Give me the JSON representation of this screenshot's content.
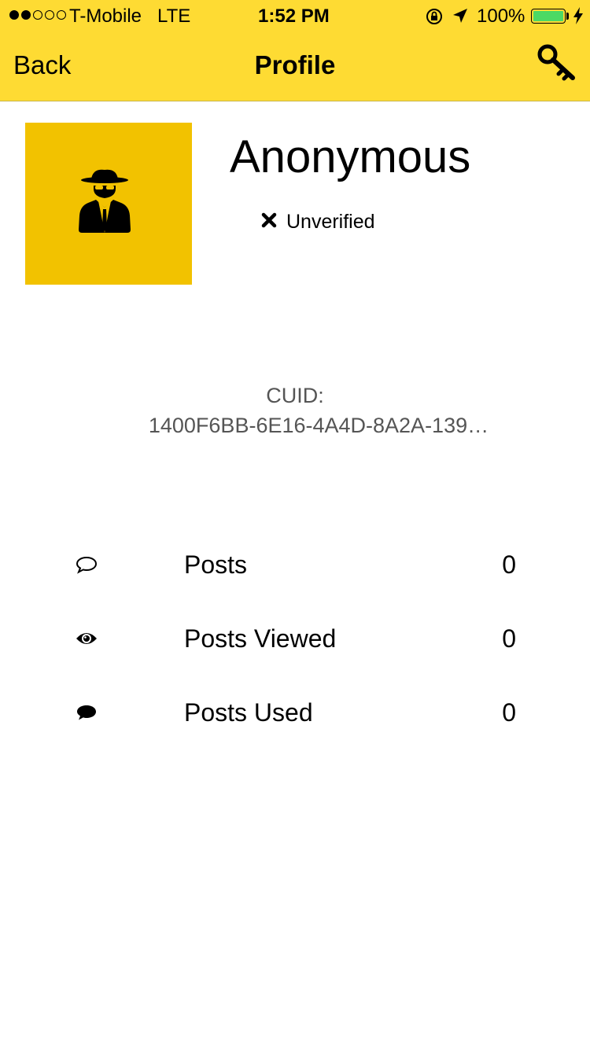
{
  "status_bar": {
    "carrier": "T-Mobile",
    "network": "LTE",
    "time": "1:52 PM",
    "battery_percent": "100%",
    "signal_bars_filled": 2,
    "signal_bars_total": 5,
    "battery_color": "#4cd964"
  },
  "nav": {
    "back_label": "Back",
    "title": "Profile",
    "right_icon": "key-icon",
    "background_color": "#fedb33"
  },
  "profile": {
    "name": "Anonymous",
    "avatar_icon": "spy-icon",
    "avatar_color": "#f2c200",
    "verification_status": "Unverified",
    "verification_icon": "x-icon"
  },
  "cuid": {
    "label": "CUID:",
    "value": "1400F6BB-6E16-4A4D-8A2A-139…"
  },
  "stats": [
    {
      "icon": "speech-bubble-outline-icon",
      "label": "Posts",
      "value": "0"
    },
    {
      "icon": "eye-icon",
      "label": "Posts Viewed",
      "value": "0"
    },
    {
      "icon": "speech-bubble-filled-icon",
      "label": "Posts Used",
      "value": "0"
    }
  ]
}
